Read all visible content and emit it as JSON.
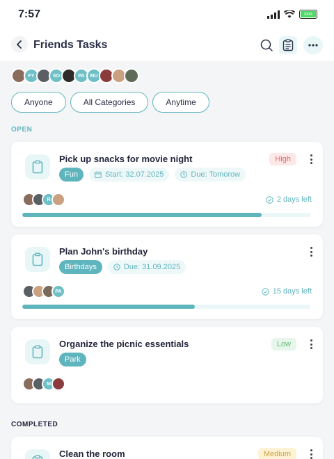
{
  "status": {
    "time": "7:57",
    "battery": "100%"
  },
  "header": {
    "title": "Friends Tasks"
  },
  "friends": [
    {
      "initials": "",
      "color": "#8a6c5c"
    },
    {
      "initials": "FY",
      "color": "#6fbfc6"
    },
    {
      "initials": "",
      "color": "#5a5f66"
    },
    {
      "initials": "SO",
      "color": "#6fbfc6"
    },
    {
      "initials": "",
      "color": "#2f2b2b"
    },
    {
      "initials": "PA",
      "color": "#6fbfc6"
    },
    {
      "initials": "MU",
      "color": "#6fbfc6"
    },
    {
      "initials": "",
      "color": "#8b3b3b"
    },
    {
      "initials": "",
      "color": "#c9a080"
    },
    {
      "initials": "",
      "color": "#5e6b57"
    }
  ],
  "filters": {
    "who": "Anyone",
    "category": "All Categories",
    "time": "Anytime"
  },
  "sections": {
    "open": "OPEN",
    "completed": "COMPLETED"
  },
  "colors": {
    "accent": "#5fb5bd",
    "high_bg": "#fde8e8",
    "high_fg": "#e06a6a",
    "low_bg": "#e6f6ea",
    "low_fg": "#6abd7c",
    "medium_bg": "#fdf2d3",
    "medium_fg": "#c9a23a"
  },
  "tasks": [
    {
      "title": "Pick up snacks for movie night",
      "category": "Fun",
      "start": "Start: 32.07.2025",
      "due": "Due: Tomorow",
      "priority": "High",
      "days_left": "2 days left",
      "progress": 0.83,
      "assignees": [
        {
          "initials": "",
          "color": "#8a6c5c"
        },
        {
          "initials": "",
          "color": "#5a5f66"
        },
        {
          "initials": "R",
          "color": "#6fbfc6"
        },
        {
          "initials": "",
          "color": "#c9a080"
        }
      ]
    },
    {
      "title": "Plan John's birthday",
      "category": "Birthdays",
      "due": "Due: 31.09.2025",
      "days_left": "15 days left",
      "progress": 0.6,
      "assignees": [
        {
          "initials": "",
          "color": "#5a5f66"
        },
        {
          "initials": "",
          "color": "#c9a080"
        },
        {
          "initials": "",
          "color": "#7a6a5a"
        },
        {
          "initials": "PA",
          "color": "#6fbfc6"
        }
      ]
    },
    {
      "title": "Organize the picnic essentials",
      "category": "Park",
      "priority": "Low",
      "assignees": [
        {
          "initials": "",
          "color": "#8a6c5c"
        },
        {
          "initials": "",
          "color": "#5a5f66"
        },
        {
          "initials": "M",
          "color": "#6fbfc6"
        },
        {
          "initials": "",
          "color": "#8b3b3b"
        }
      ]
    },
    {
      "title": "Clean the room",
      "priority": "Medium"
    }
  ]
}
